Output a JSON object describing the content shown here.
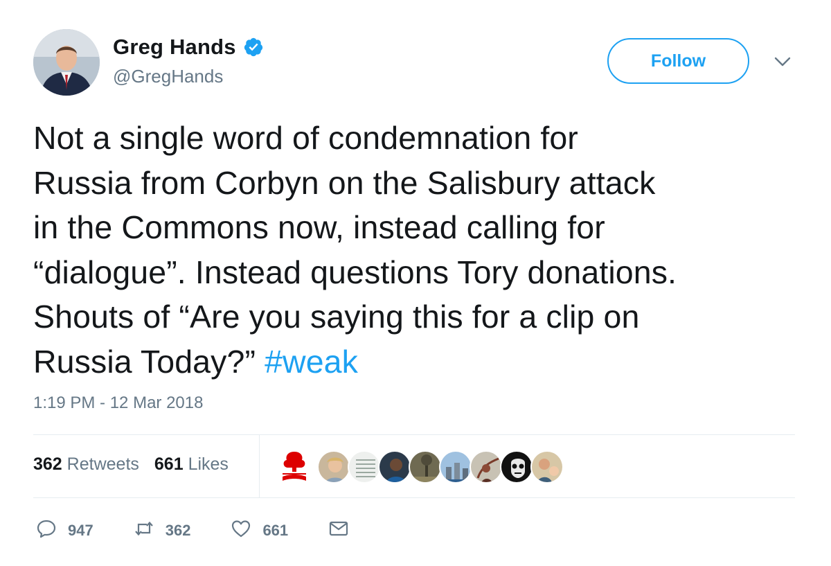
{
  "author": {
    "display_name": "Greg Hands",
    "handle": "@GregHands",
    "verified": true
  },
  "follow_label": "Follow",
  "tweet": {
    "lines": [
      "Not a single word of condemnation for",
      "Russia from Corbyn on the Salisbury attack",
      "in the Commons now, instead calling for",
      "“dialogue”. Instead questions Tory donations.",
      "Shouts of “Are you saying this for a clip on"
    ],
    "last_line_text": "Russia Today?”",
    "hashtag": "#weak"
  },
  "timestamp": "1:19 PM - 12 Mar 2018",
  "stats": {
    "retweets_count": "362",
    "retweets_label": "Retweets",
    "likes_count": "661",
    "likes_label": "Likes"
  },
  "actions": {
    "replies": "947",
    "retweets": "362",
    "likes": "661"
  },
  "colors": {
    "accent": "#1da1f2",
    "text": "#14171a",
    "secondary": "#657786",
    "divider": "#e6ecf0"
  }
}
